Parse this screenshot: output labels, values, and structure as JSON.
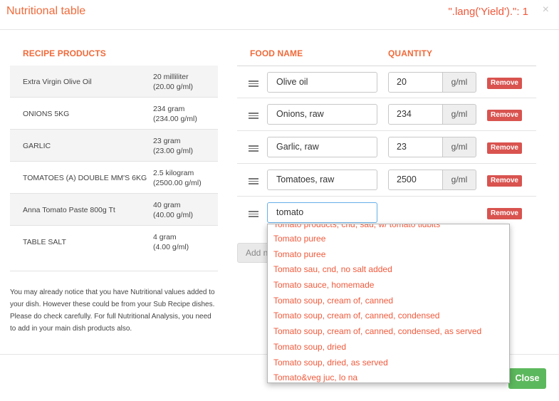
{
  "header": {
    "title": "Nutritional table",
    "yield_text": "\".lang('Yield').\": 1",
    "close_glyph": "×"
  },
  "left": {
    "heading": "RECIPE PRODUCTS",
    "products": [
      {
        "name": "Extra Virgin Olive Oil",
        "qty": "20 milliliter",
        "qty_detail": "(20.00 g/ml)"
      },
      {
        "name": "ONIONS 5KG",
        "qty": "234 gram",
        "qty_detail": "(234.00 g/ml)"
      },
      {
        "name": "GARLIC",
        "qty": "23 gram",
        "qty_detail": "(23.00 g/ml)"
      },
      {
        "name": "TOMATOES (A) DOUBLE MM'S 6KG",
        "qty": "2.5 kilogram",
        "qty_detail": "(2500.00 g/ml)"
      },
      {
        "name": "Anna Tomato Paste 800g Tt",
        "qty": "40 gram",
        "qty_detail": "(40.00 g/ml)"
      },
      {
        "name": "TABLE SALT",
        "qty": "4 gram",
        "qty_detail": "(4.00 g/ml)"
      }
    ],
    "notice": "You may already notice that you have Nutritional values added to your dish. However these could be from your Sub Recipe dishes. Please do check carefully. For full Nutritional Analysis, you need to add in your main dish products also."
  },
  "right": {
    "food_heading": "FOOD NAME",
    "qty_heading": "QUANTITY",
    "rows": [
      {
        "name": "Olive oil",
        "qty": "20",
        "unit": "g/ml",
        "remove": "Remove"
      },
      {
        "name": "Onions, raw",
        "qty": "234",
        "unit": "g/ml",
        "remove": "Remove"
      },
      {
        "name": "Garlic, raw",
        "qty": "23",
        "unit": "g/ml",
        "remove": "Remove"
      },
      {
        "name": "Tomatoes, raw",
        "qty": "2500",
        "unit": "g/ml",
        "remove": "Remove"
      },
      {
        "name": "tomato",
        "remove": "Remove"
      }
    ],
    "add_label": "Add ne"
  },
  "dropdown": {
    "partial_item": "Tomato products, cnd, sau, w/ tomato tidbits",
    "items": [
      "Tomato puree",
      "Tomato puree",
      "Tomato sau, cnd, no salt added",
      "Tomato sauce, homemade",
      "Tomato soup, cream of, canned",
      "Tomato soup, cream of, canned, condensed",
      "Tomato soup, cream of, canned, condensed, as served",
      "Tomato soup, dried",
      "Tomato soup, dried, as served",
      "Tomato&veg juc, lo na"
    ]
  },
  "footer": {
    "close_label": "Close"
  },
  "colors": {
    "accent": "#f06a3a",
    "remove": "#d9534f",
    "close": "#5cb85c",
    "dropdown_text": "#f05a3c"
  }
}
